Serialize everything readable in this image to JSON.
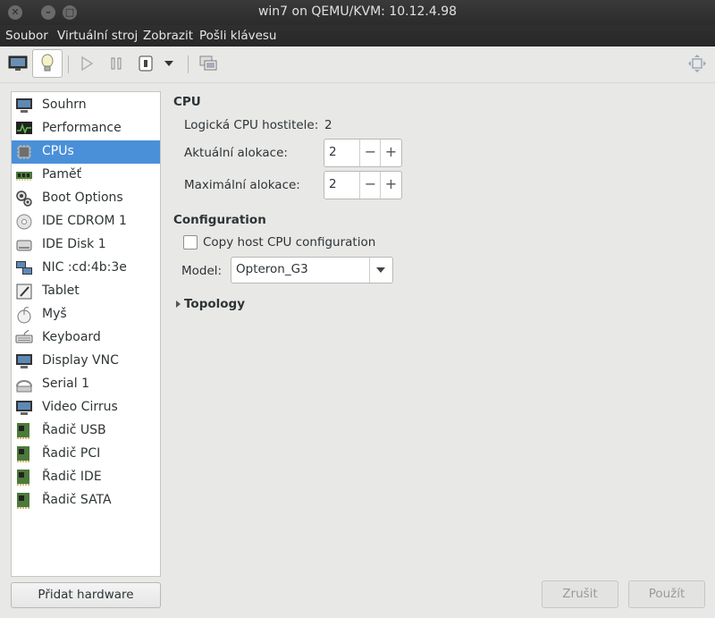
{
  "window": {
    "title": "win7 on QEMU/KVM: 10.12.4.98"
  },
  "menu": {
    "soubor": "Soubor",
    "virtualni": "Virtuální stroj",
    "zobrazit": "Zobrazit",
    "posli": "Pošli klávesu"
  },
  "sidebar": {
    "items": [
      {
        "label": "Souhrn",
        "icon": "monitor-icon"
      },
      {
        "label": "Performance",
        "icon": "performance-icon"
      },
      {
        "label": "CPUs",
        "icon": "cpu-icon"
      },
      {
        "label": "Paměť",
        "icon": "memory-icon"
      },
      {
        "label": "Boot Options",
        "icon": "boot-gears-icon"
      },
      {
        "label": "IDE CDROM 1",
        "icon": "cdrom-icon"
      },
      {
        "label": "IDE Disk 1",
        "icon": "disk-icon"
      },
      {
        "label": "NIC :cd:4b:3e",
        "icon": "network-icon"
      },
      {
        "label": "Tablet",
        "icon": "tablet-icon"
      },
      {
        "label": "Myš",
        "icon": "mouse-icon"
      },
      {
        "label": "Keyboard",
        "icon": "keyboard-icon"
      },
      {
        "label": "Display VNC",
        "icon": "display-icon"
      },
      {
        "label": "Serial 1",
        "icon": "serial-icon"
      },
      {
        "label": "Video Cirrus",
        "icon": "video-icon"
      },
      {
        "label": "Řadič USB",
        "icon": "controller-icon"
      },
      {
        "label": "Řadič PCI",
        "icon": "controller-icon"
      },
      {
        "label": "Řadič IDE",
        "icon": "controller-icon"
      },
      {
        "label": "Řadič SATA",
        "icon": "controller-icon"
      }
    ],
    "selected": "CPUs",
    "add_button": "Přidat hardware"
  },
  "cpu": {
    "heading": "CPU",
    "host_label": "Logická CPU hostitele:",
    "host_value": "2",
    "current_label": "Aktuální alokace:",
    "current_value": "2",
    "max_label": "Maximální alokace:",
    "max_value": "2",
    "minus": "−",
    "plus": "+"
  },
  "config": {
    "heading": "Configuration",
    "copy_host_label": "Copy host CPU configuration",
    "model_label": "Model:",
    "model_value": "Opteron_G3",
    "topology_label": "Topology"
  },
  "buttons": {
    "cancel": "Zrušit",
    "apply": "Použít"
  },
  "colors": {
    "selection": "#4a90d9",
    "titlebar": "#2b2b2b"
  }
}
